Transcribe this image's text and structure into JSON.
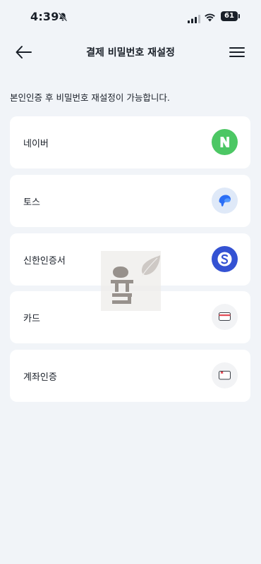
{
  "status_bar": {
    "time": "4:39",
    "battery": "61"
  },
  "header": {
    "title": "결제 비밀번호 재설정",
    "back_icon": "arrow-left-icon",
    "menu_icon": "hamburger-menu-icon"
  },
  "description": "본인인증 후 비밀번호 재설정이 가능합니다.",
  "methods": [
    {
      "label": "네이버",
      "icon": "naver-icon",
      "color": "#4cc764"
    },
    {
      "label": "토스",
      "icon": "toss-icon",
      "color": "#2b6ef6"
    },
    {
      "label": "신한인증서",
      "icon": "shinhan-icon",
      "color": "#3452d3"
    },
    {
      "label": "카드",
      "icon": "card-icon",
      "color": "#e14b55"
    },
    {
      "label": "계좌인증",
      "icon": "account-icon",
      "color": "#e14b55"
    }
  ],
  "colors": {
    "background": "#f1f4f8",
    "card": "#ffffff",
    "text": "#191f28"
  }
}
